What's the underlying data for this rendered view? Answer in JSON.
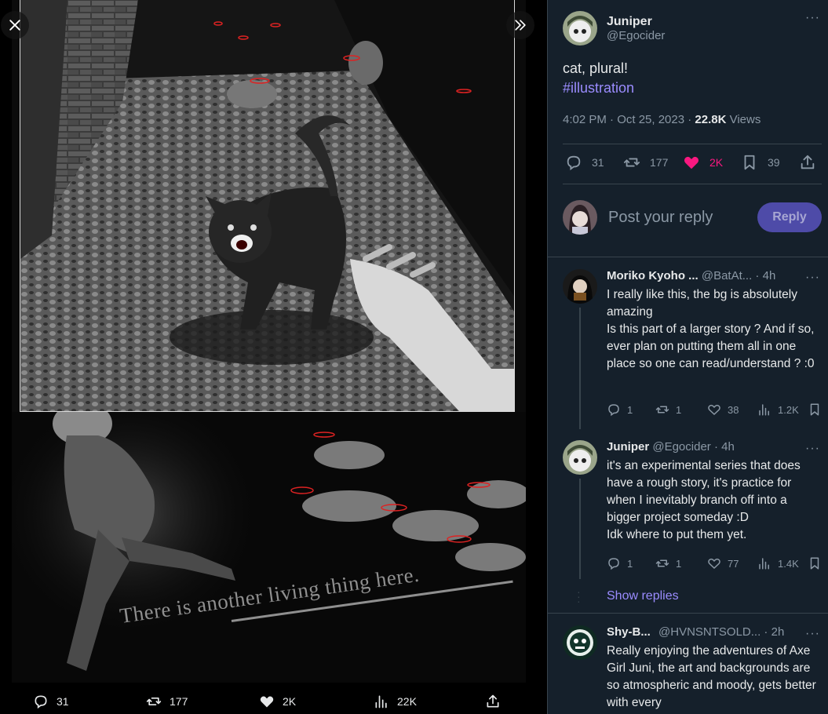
{
  "viewer": {
    "overlay_text": "There is another living thing here.",
    "actions": {
      "replies": "31",
      "reposts": "177",
      "likes": "2K",
      "views": "22K"
    }
  },
  "tweet": {
    "display_name": "Juniper",
    "handle": "@Egocider",
    "text": "cat, plural!",
    "hashtag": "#illustration",
    "time": "4:02 PM · Oct 25, 2023 · ",
    "views_count": "22.8K",
    "views_label": " Views",
    "stats": {
      "replies": "31",
      "reposts": "177",
      "likes": "2K",
      "bookmarks": "39"
    }
  },
  "reply_box": {
    "placeholder": "Post your reply",
    "button": "Reply"
  },
  "replies": [
    {
      "display_name": "Moriko Kyoho ...",
      "handle": "@BatAt...",
      "time": " · 4h",
      "text": "I really like this, the bg is absolutely amazing\nIs this part of a larger story ? And if so, ever plan on putting them all in one place so one can read/understand ? :0",
      "replies": "1",
      "reposts": "1",
      "likes": "38",
      "views": "1.2K"
    },
    {
      "display_name": "Juniper",
      "handle": "@Egocider",
      "time": " · 4h",
      "text": "it's an experimental series that does have a rough story, it's practice for when I inevitably branch off into a bigger project someday :D\nIdk where to put them yet.",
      "replies": "1",
      "reposts": "1",
      "likes": "77",
      "views": "1.4K"
    },
    {
      "display_name": "Shy-B...",
      "handle": "@HVNSNTSOLD...",
      "time": " · 2h",
      "text": "Really enjoying the adventures of Axe Girl Juni, the art and backgrounds are so atmospheric and moody, gets better with every"
    }
  ],
  "show_replies": "Show replies",
  "colors": {
    "background": "#15202b",
    "accent_purple": "#9b8cff",
    "like_pink": "#f91880",
    "reply_button": "#4e4ba8"
  }
}
